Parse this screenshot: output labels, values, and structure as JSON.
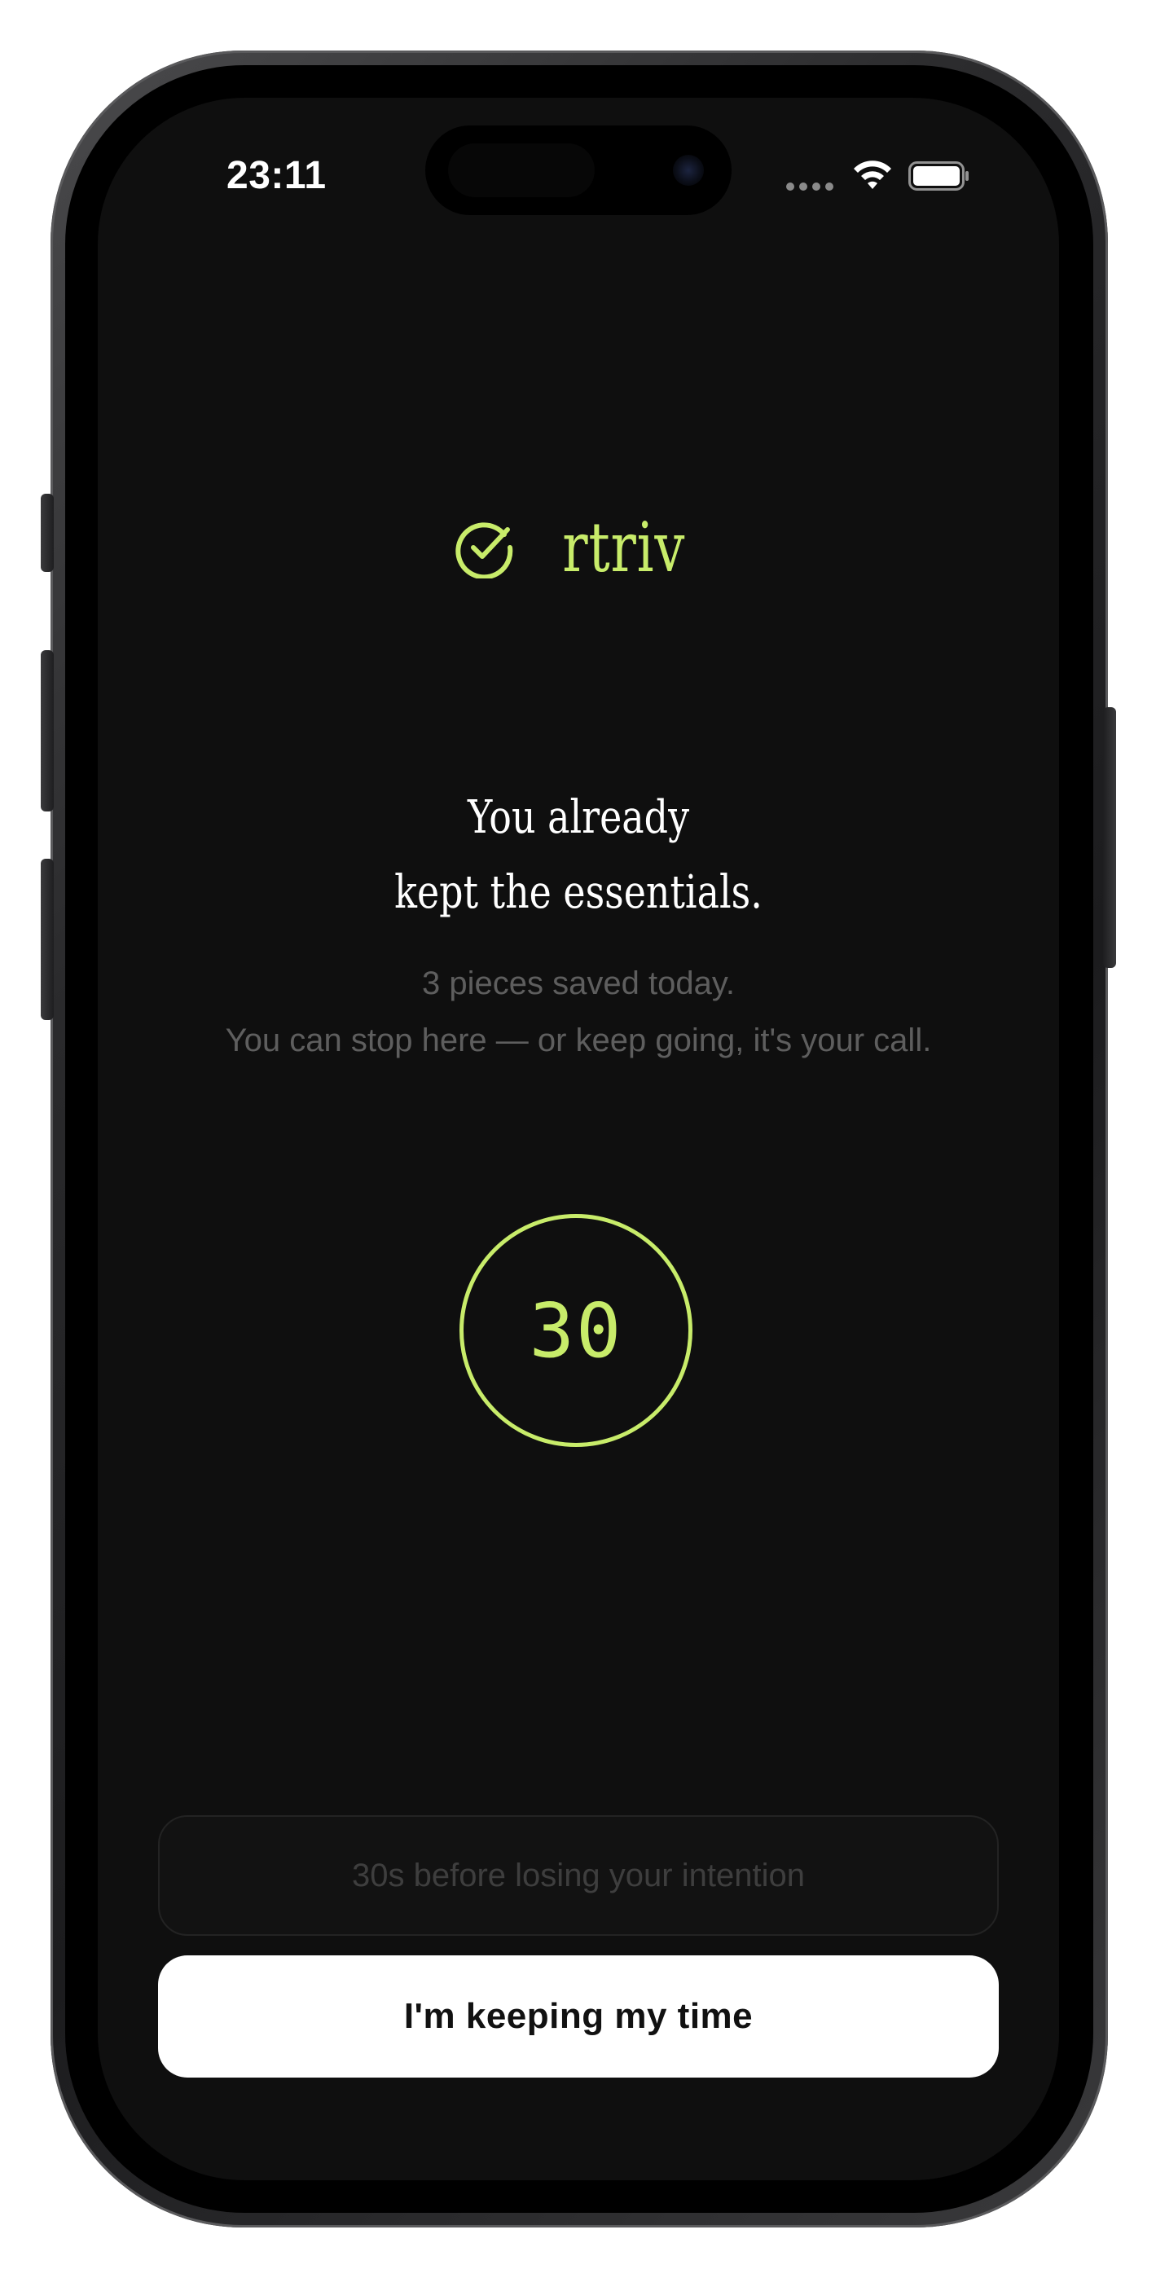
{
  "status_bar": {
    "time": "23:11",
    "wifi_icon": "wifi-icon",
    "battery_icon": "battery-icon",
    "signal_icon": "cellular-dots-icon"
  },
  "brand": {
    "name": "rtriv",
    "icon": "check-circle-icon",
    "color": "#c8ec6a"
  },
  "headline": {
    "line1": "You already",
    "line2": "kept the essentials."
  },
  "subtext": {
    "line1": "3 pieces saved today.",
    "line2": "You can stop here — or keep going, it's your call."
  },
  "countdown": {
    "value": "30",
    "accent": "#c8ec6a"
  },
  "intention_timer": {
    "label": "30s before losing your intention"
  },
  "actions": {
    "keep_label": "I'm keeping my time"
  },
  "colors": {
    "background": "#0f0f0f",
    "accent": "#c8ec6a",
    "muted_text": "#5e5e5e",
    "button_bg": "#ffffff"
  }
}
